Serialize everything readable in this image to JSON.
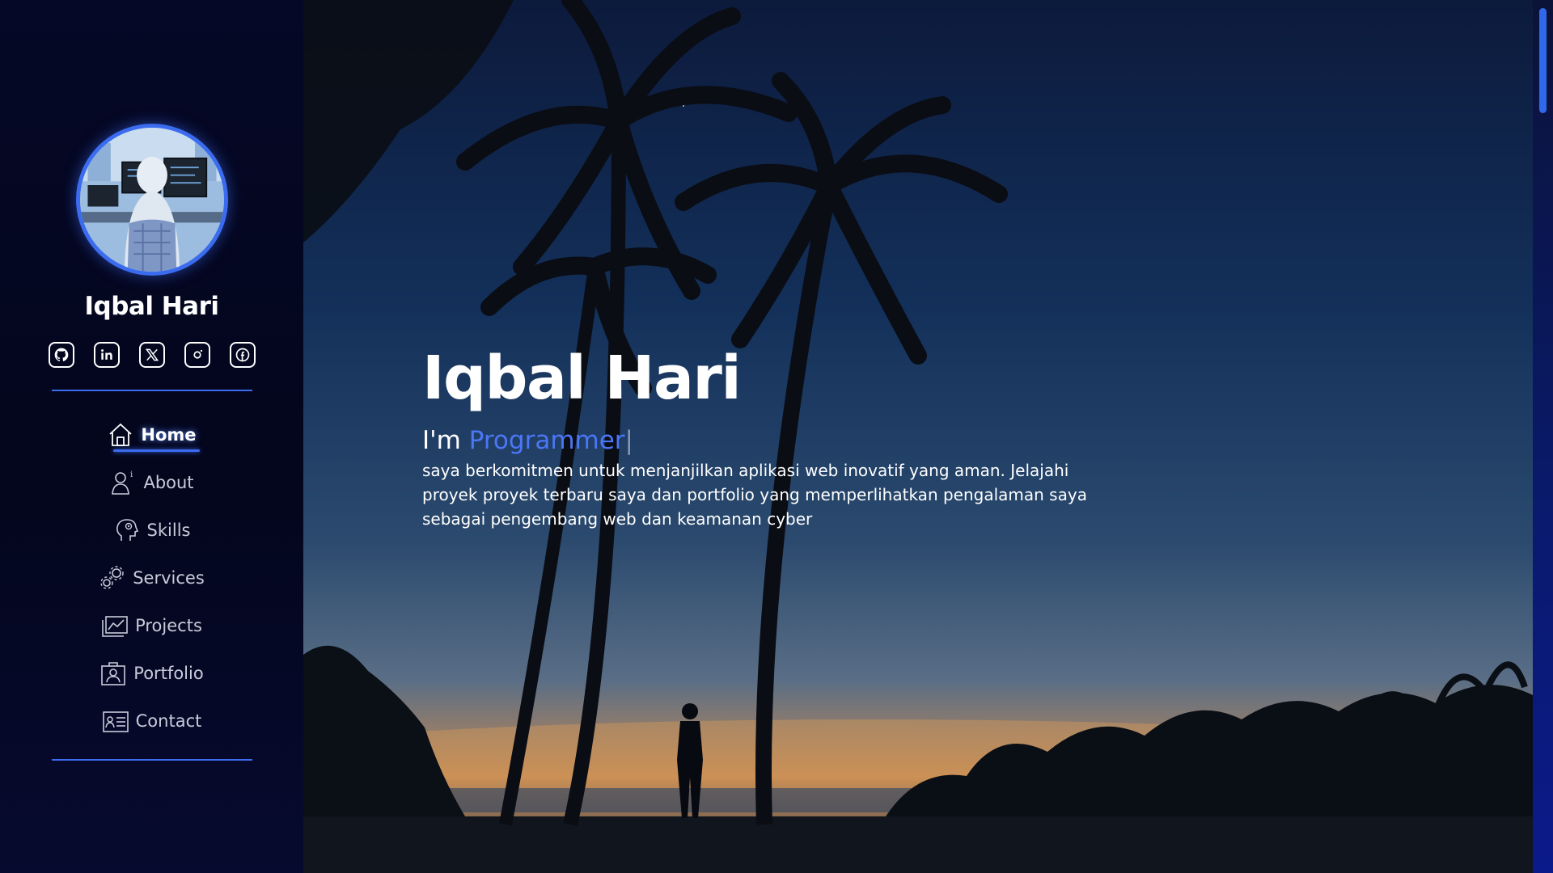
{
  "sidebar": {
    "profile_name": "Iqbal Hari",
    "avatar_icon": "programmer-avatar",
    "socials": [
      {
        "icon": "github-icon"
      },
      {
        "icon": "linkedin-icon"
      },
      {
        "icon": "x-twitter-icon"
      },
      {
        "icon": "instagram-icon"
      },
      {
        "icon": "facebook-icon"
      }
    ],
    "nav": [
      {
        "label": "Home",
        "icon": "home-icon",
        "active": true
      },
      {
        "label": "About",
        "icon": "person-info-icon"
      },
      {
        "label": "Skills",
        "icon": "brain-icon"
      },
      {
        "label": "Services",
        "icon": "gears-icon"
      },
      {
        "label": "Projects",
        "icon": "chart-icon"
      },
      {
        "label": "Portfolio",
        "icon": "portfolio-icon"
      },
      {
        "label": "Contact",
        "icon": "contact-card-icon"
      }
    ]
  },
  "hero": {
    "title": "Iqbal Hari",
    "role_prefix": "I'm ",
    "role_word": "Programmer",
    "cursor": "|",
    "description": "saya berkomitmen untuk menjanjilkan aplikasi web inovatif yang aman. Jelajahi proyek proyek terbaru saya dan portfolio yang memperlihatkan pengalaman saya sebagai pengembang web dan keamanan cyber"
  },
  "colors": {
    "accent": "#3b6cf0",
    "role_word": "#4b76f5",
    "sidebar_bg": "#04061d"
  }
}
